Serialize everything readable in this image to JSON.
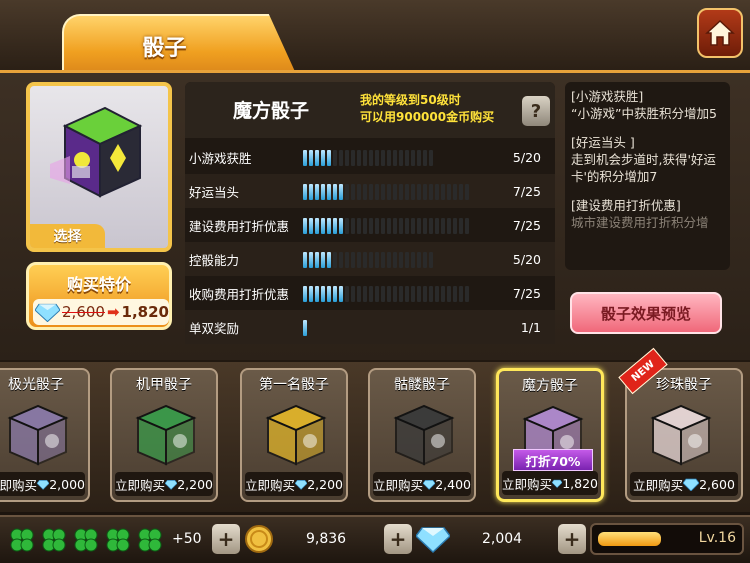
{
  "tab": {
    "label": "骰子"
  },
  "featured": {
    "select_label": "选择"
  },
  "buy": {
    "title": "购买特价",
    "old_price": "2,600",
    "new_price": "1,820"
  },
  "stats": {
    "dice_name": "魔方骰子",
    "unlock_note_line1": "我的等级到50级时",
    "unlock_note_line2": "可以用900000金币购买",
    "help_label": "?",
    "rows": [
      {
        "label": "小游戏获胜",
        "value": "5/20",
        "current": 5,
        "max": 20
      },
      {
        "label": "好运当头",
        "value": "7/25",
        "current": 7,
        "max": 25
      },
      {
        "label": "建设费用打折优惠",
        "value": "7/25",
        "current": 7,
        "max": 25
      },
      {
        "label": "控骰能力",
        "value": "5/20",
        "current": 5,
        "max": 20
      },
      {
        "label": "收购费用打折优惠",
        "value": "7/25",
        "current": 7,
        "max": 25
      },
      {
        "label": "单双奖励",
        "value": "1/1",
        "current": 1,
        "max": 1
      }
    ]
  },
  "description": {
    "p1_title": "[小游戏获胜]",
    "p1_body": "“小游戏”中获胜积分增加5",
    "p2_title": "[好运当头 ]",
    "p2_body": "走到机会步道时,获得'好运卡'的积分增加7",
    "p3_title": "[建设费用打折优惠]",
    "p3_body": "城市建设费用打折积分增"
  },
  "preview_button": "骰子效果预览",
  "dice_list": [
    {
      "name": "极光骰子",
      "buy": "立即购买",
      "price": "2,000",
      "color": "#8a7aa8"
    },
    {
      "name": "机甲骰子",
      "buy": "立即购买",
      "price": "2,200",
      "color": "#3a9a4a"
    },
    {
      "name": "第一名骰子",
      "buy": "立即购买",
      "price": "2,200",
      "color": "#e0b42a"
    },
    {
      "name": "骷髅骰子",
      "buy": "立即购买",
      "price": "2,400",
      "color": "#3a3a3a"
    },
    {
      "name": "魔方骰子",
      "buy": "立即购买",
      "price": "1,820",
      "color": "#b08ad0",
      "discount": "打折70%"
    },
    {
      "name": "珍珠骰子",
      "buy": "立即购买",
      "price": "2,600",
      "color": "#e8d8d8",
      "badge": "NEW"
    }
  ],
  "resources": {
    "clover_extra": "+50",
    "coins": "9,836",
    "gems": "2,004",
    "level": "Lv.16",
    "xp_fraction": 0.45
  },
  "colors": {
    "accent": "#f0a020",
    "gem": "#7fd4ff",
    "bar": "#2a9fd8"
  }
}
